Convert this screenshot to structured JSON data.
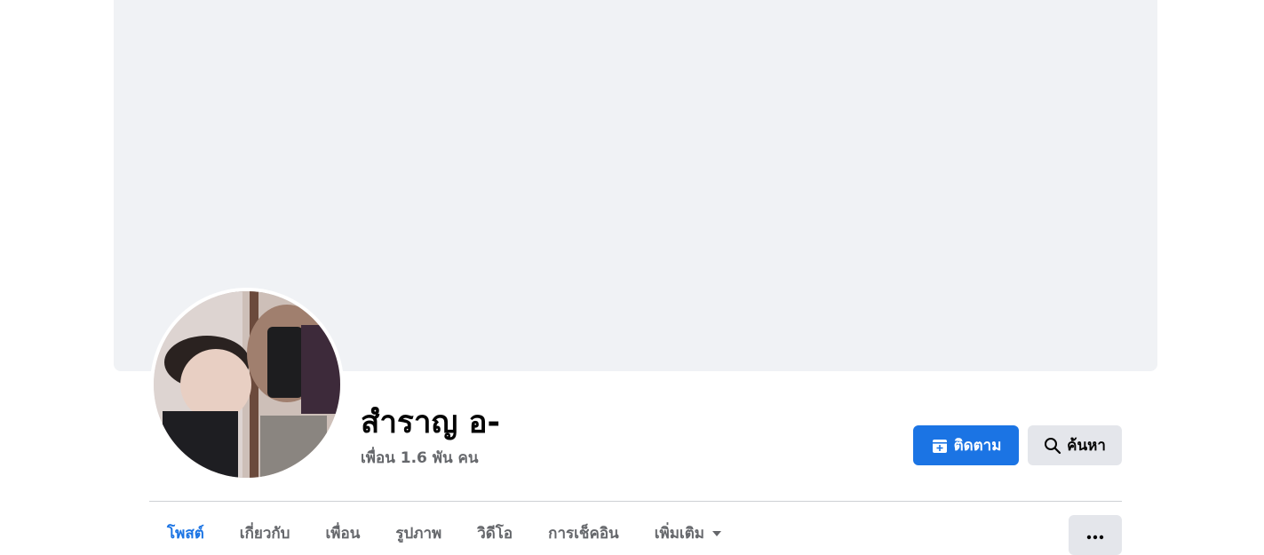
{
  "profile": {
    "name": "สำราญ อ-",
    "friends_text": "เพื่อน 1.6 พัน คน"
  },
  "actions": {
    "follow_label": "ติดตาม",
    "search_label": "ค้นหา"
  },
  "tabs": [
    {
      "label": "โพสต์",
      "active": true
    },
    {
      "label": "เกี่ยวกับ",
      "active": false
    },
    {
      "label": "เพื่อน",
      "active": false
    },
    {
      "label": "รูปภาพ",
      "active": false
    },
    {
      "label": "วิดีโอ",
      "active": false
    },
    {
      "label": "การเช็คอิน",
      "active": false
    },
    {
      "label": "เพิ่มเติม",
      "active": false
    }
  ],
  "icons": {
    "follow": "follow-plus-icon",
    "search": "search-icon",
    "more_tabs": "caret-down-icon",
    "overflow": "more-dots-icon"
  },
  "colors": {
    "accent": "#1b74e4",
    "cover": "#f0f2f5",
    "secondary_button": "#e4e6eb",
    "muted_text": "#65676b"
  }
}
